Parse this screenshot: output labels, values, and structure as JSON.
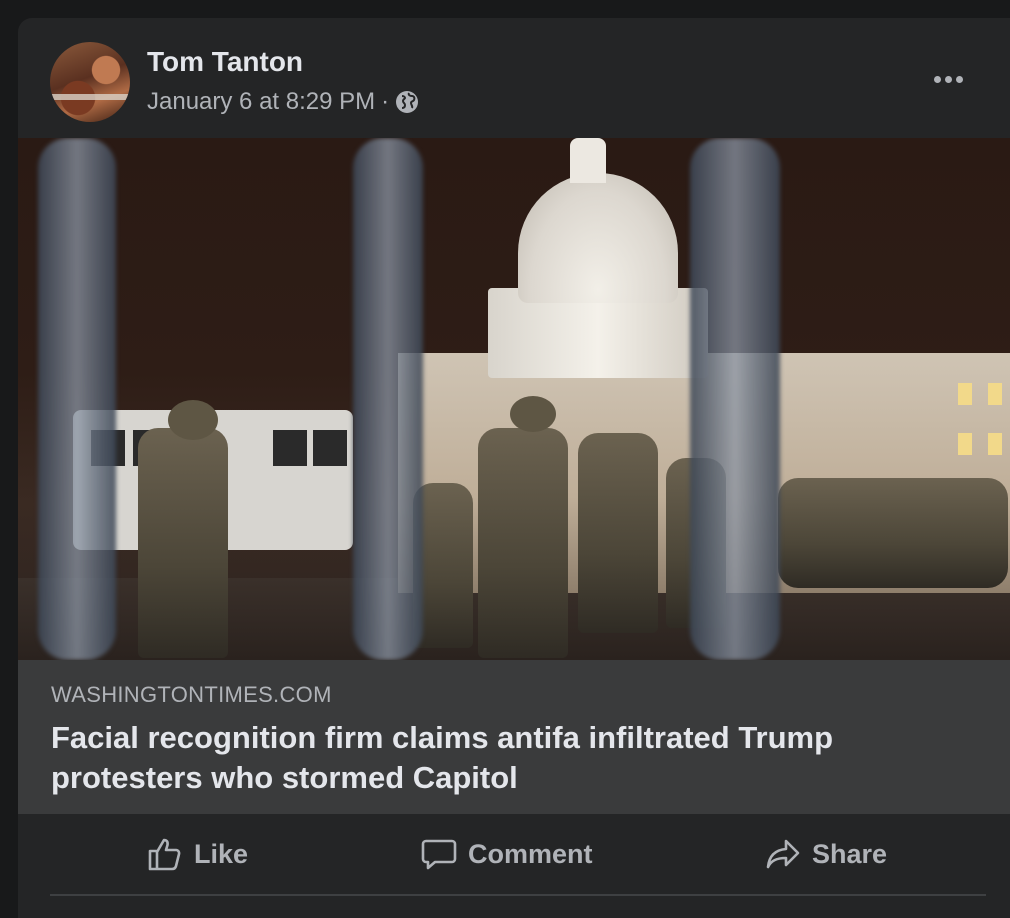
{
  "post": {
    "author": "Tom Tanton",
    "timestamp": "January 6 at 8:29 PM",
    "separator": "·",
    "privacy_icon": "globe-icon",
    "more_icon": "more-options-icon"
  },
  "link_preview": {
    "domain": "WASHINGTONTIMES.COM",
    "headline": "Facial recognition firm claims antifa infiltrated Trump protesters who stormed Capitol"
  },
  "actions": {
    "like_label": "Like",
    "comment_label": "Comment",
    "share_label": "Share"
  },
  "colors": {
    "card_bg": "#242526",
    "link_bg": "#3a3b3c",
    "text_primary": "#e4e6eb",
    "text_secondary": "#b0b3b8"
  }
}
